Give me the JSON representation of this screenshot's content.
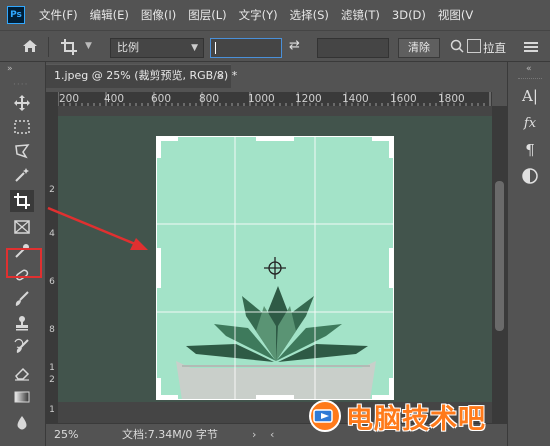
{
  "app": {
    "logo_text": "Ps"
  },
  "menu": {
    "items": [
      "文件(F)",
      "编辑(E)",
      "图像(I)",
      "图层(L)",
      "文字(Y)",
      "选择(S)",
      "滤镜(T)",
      "3D(D)",
      "视图(V"
    ]
  },
  "options": {
    "ratio_select": "比例",
    "width_value": "",
    "height_value": "",
    "clear_label": "清除",
    "straighten_label": "拉直"
  },
  "document": {
    "tab_title": "1.jpeg @ 25% (裁剪预览, RGB/8) *",
    "close_symbol": "×"
  },
  "ruler": {
    "h_labels": [
      "200",
      "400",
      "600",
      "800",
      "1000",
      "1200",
      "1400",
      "1600",
      "1800"
    ],
    "v_labels": [
      "2",
      "4",
      "6",
      "8",
      "1",
      "2",
      "1"
    ]
  },
  "status": {
    "zoom": "25%",
    "doc_info": "文档:7.34M/0 字节",
    "arrow_left": "‹",
    "arrow_right": "›"
  },
  "watermark": {
    "text": "电脑技术吧"
  },
  "colors": {
    "ui_bg": "#535353",
    "image_teal": "#a3e3c8",
    "highlight_red": "#e03030",
    "watermark_orange": "#ff7a1a"
  }
}
